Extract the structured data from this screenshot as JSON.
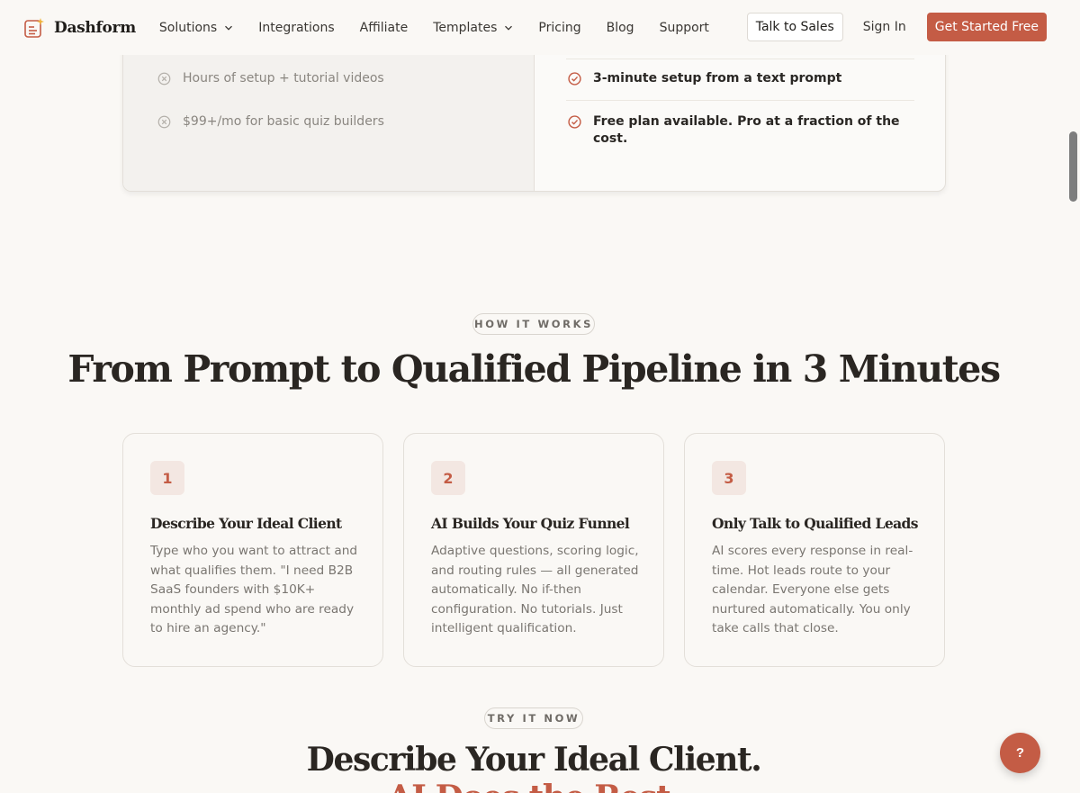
{
  "nav": {
    "brand": "Dashform",
    "links": [
      {
        "label": "Solutions",
        "dropdown": true
      },
      {
        "label": "Integrations",
        "dropdown": false
      },
      {
        "label": "Affiliate",
        "dropdown": false
      },
      {
        "label": "Templates",
        "dropdown": true
      },
      {
        "label": "Pricing",
        "dropdown": false
      },
      {
        "label": "Blog",
        "dropdown": false
      },
      {
        "label": "Support",
        "dropdown": false
      }
    ],
    "talk_to_sales": "Talk to Sales",
    "sign_in": "Sign In",
    "get_started": "Get Started Free"
  },
  "comparison": {
    "old": [
      {
        "text": "Hours of setup + tutorial videos",
        "icon": "x-circle-icon"
      },
      {
        "text": "$99+/mo for basic quiz builders",
        "icon": "x-circle-icon"
      }
    ],
    "new": [
      {
        "text": "3-minute setup from a text prompt",
        "icon": "check-circle-icon"
      },
      {
        "text": "Free plan available. Pro at a fraction of the cost.",
        "icon": "check-circle-icon"
      }
    ]
  },
  "how_it_works": {
    "eyebrow": "HOW IT WORKS",
    "title": "From Prompt to Qualified Pipeline in 3 Minutes",
    "steps": [
      {
        "number": "1",
        "title": "Describe Your Ideal Client",
        "body": "Type who you want to attract and what qualifies them. \"I need B2B SaaS founders with $10K+ monthly ad spend who are ready to hire an agency.\""
      },
      {
        "number": "2",
        "title": "AI Builds Your Quiz Funnel",
        "body": "Adaptive questions, scoring logic, and routing rules — all generated automatically. No if-then configuration. No tutorials. Just intelligent qualification."
      },
      {
        "number": "3",
        "title": "Only Talk to Qualified Leads",
        "body": "AI scores every response in real-time. Hot leads route to your calendar. Everyone else gets nurtured automatically. You only take calls that close."
      }
    ]
  },
  "try_it_now": {
    "eyebrow": "TRY IT NOW",
    "title": "Describe Your Ideal Client.",
    "subtitle_partial": "AI Does the Rest."
  },
  "help": {
    "label": "?"
  },
  "colors": {
    "accent": "#c45c45",
    "background": "#faf8f5",
    "heading": "#2a2622",
    "muted_text": "#7a7671"
  }
}
